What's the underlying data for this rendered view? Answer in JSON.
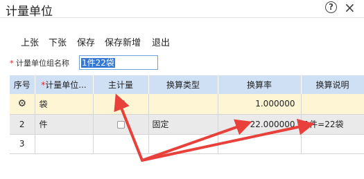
{
  "window": {
    "title": "计量单位",
    "help_icon": "?",
    "close_icon": "×"
  },
  "toolbar": {
    "prev": "上张",
    "next": "下张",
    "save": "保存",
    "save_new": "保存新增",
    "exit": "退出"
  },
  "group": {
    "required_mark": "*",
    "label": "计量单位组名称",
    "value": "1件22袋"
  },
  "grid": {
    "columns": {
      "seq": "序号",
      "name_req": "*",
      "name": "计量单位...",
      "main": "主计量",
      "conv_type": "换算类型",
      "rate": "换算率",
      "desc": "换算说明"
    },
    "rows": [
      {
        "seq_icon": "gear-icon",
        "name": "袋",
        "main_checked": true,
        "conv_type": "",
        "rate": "1.000000",
        "desc": ""
      },
      {
        "seq": "2",
        "name": "件",
        "main_checked": false,
        "conv_type": "固定",
        "rate": "22.000000",
        "desc": "1件=22袋"
      },
      {
        "seq": "3",
        "name": "",
        "conv_type": "",
        "rate": "",
        "desc": ""
      }
    ]
  },
  "colors": {
    "header_bg": "#cfe0f5",
    "selected_row": "#fdf5d4",
    "arrow": "#e8403a"
  }
}
